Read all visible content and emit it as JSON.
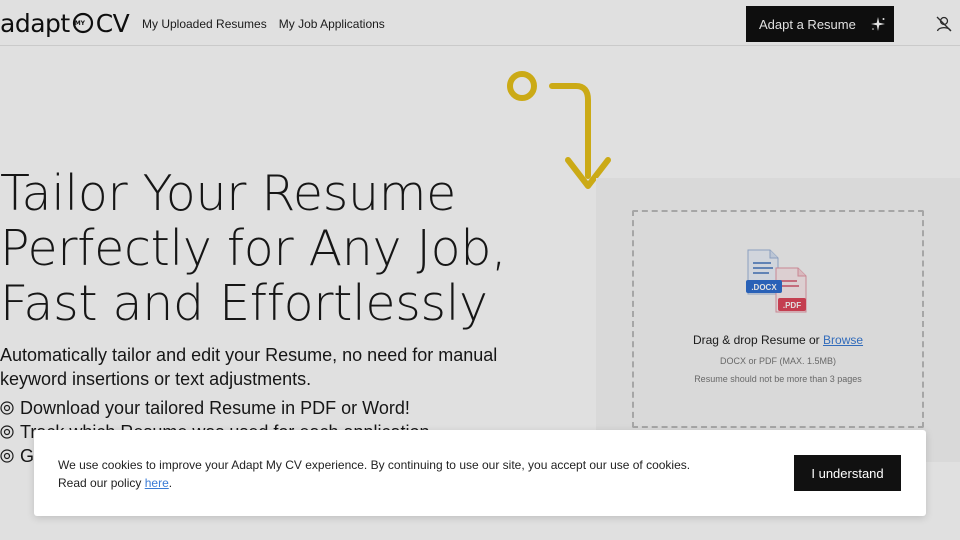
{
  "header": {
    "logo_left": "adapt",
    "logo_mark_text": "MY",
    "logo_right": "CV",
    "nav": [
      {
        "label": "My Uploaded Resumes"
      },
      {
        "label": "My Job Applications"
      }
    ],
    "cta_label": "Adapt a Resume"
  },
  "hero": {
    "title_lines": [
      "Tailor Your Resume",
      "Perfectly for Any Job,",
      "Fast and Effortlessly"
    ],
    "subtitle_line1": "Automatically tailor and edit your Resume, no need for manual",
    "subtitle_line2": "keyword insertions or text adjustments.",
    "features": [
      {
        "text": "Download your tailored Resume in PDF or Word!"
      },
      {
        "text": "Track which Resume was used for each application"
      },
      {
        "text": "G"
      }
    ]
  },
  "upload": {
    "drop_label": "Drag & drop Resume or ",
    "browse_label": "Browse",
    "formats": "DOCX or PDF (MAX. 1.5MB)",
    "page_limit": "Resume should not be more than 3 pages",
    "docx_badge": ".DOCX",
    "pdf_badge": ".PDF"
  },
  "cookie": {
    "line1": "We use cookies to improve your Adapt My CV experience. By continuing to use our site, you accept our use of cookies.",
    "line2_prefix": "Read our policy ",
    "link_label": "here",
    "line2_suffix": ".",
    "accept_label": "I understand"
  },
  "colors": {
    "accent_yellow": "#e8c21a",
    "button_dark": "#111111",
    "link_blue": "#3a7bd5"
  }
}
